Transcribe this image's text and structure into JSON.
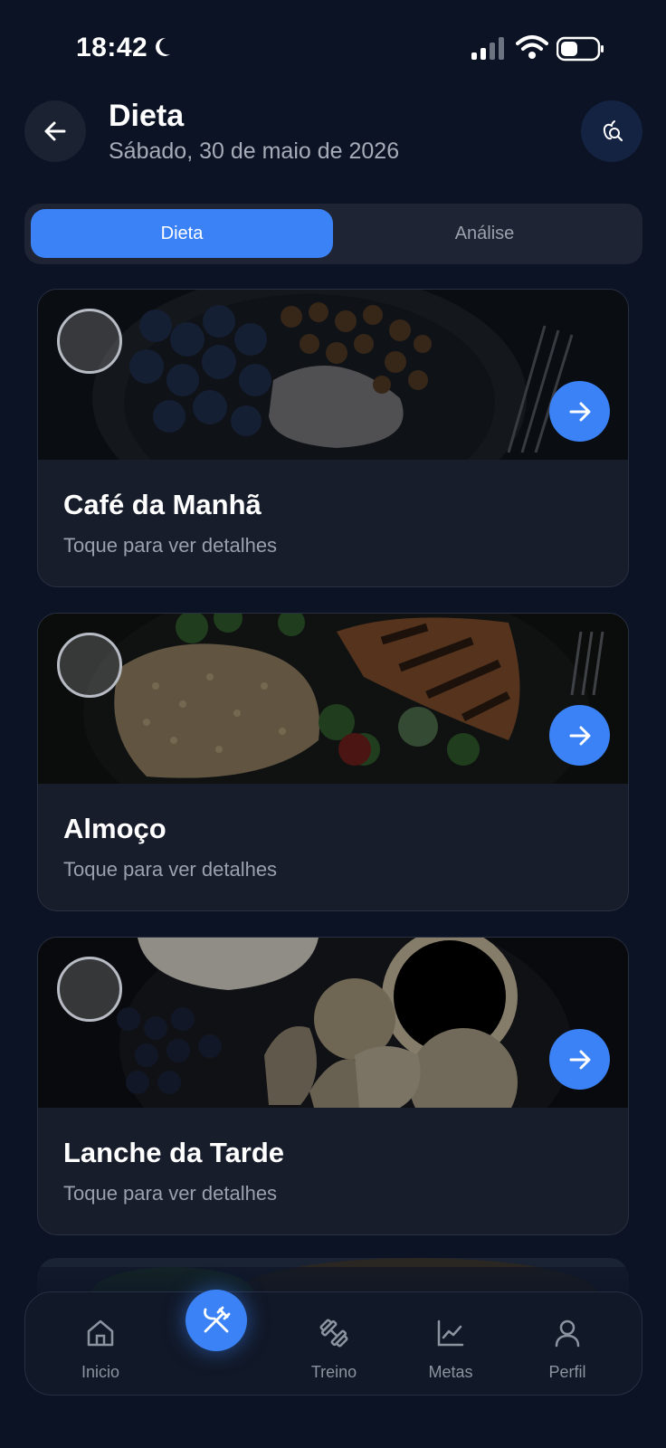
{
  "status_bar": {
    "time": "18:42"
  },
  "header": {
    "title": "Dieta",
    "subtitle": "Sábado, 30 de maio de 2026"
  },
  "tabs": [
    {
      "label": "Dieta",
      "active": true
    },
    {
      "label": "Análise",
      "active": false
    }
  ],
  "meals": [
    {
      "title": "Café da Manhã",
      "subtitle": "Toque para ver detalhes"
    },
    {
      "title": "Almoço",
      "subtitle": "Toque para ver detalhes"
    },
    {
      "title": "Lanche da Tarde",
      "subtitle": "Toque para ver detalhes"
    }
  ],
  "bottom_nav": {
    "items": [
      {
        "label": "Inicio",
        "icon": "home-icon"
      },
      {
        "label": "",
        "icon": "fork-knife-icon",
        "active": true
      },
      {
        "label": "Treino",
        "icon": "dumbbell-icon"
      },
      {
        "label": "Metas",
        "icon": "chart-icon"
      },
      {
        "label": "Perfil",
        "icon": "user-icon"
      }
    ]
  },
  "colors": {
    "background": "#0b1324",
    "accent": "#3b82f6",
    "card": "#171d2b",
    "muted_text": "#9aa1ad"
  }
}
